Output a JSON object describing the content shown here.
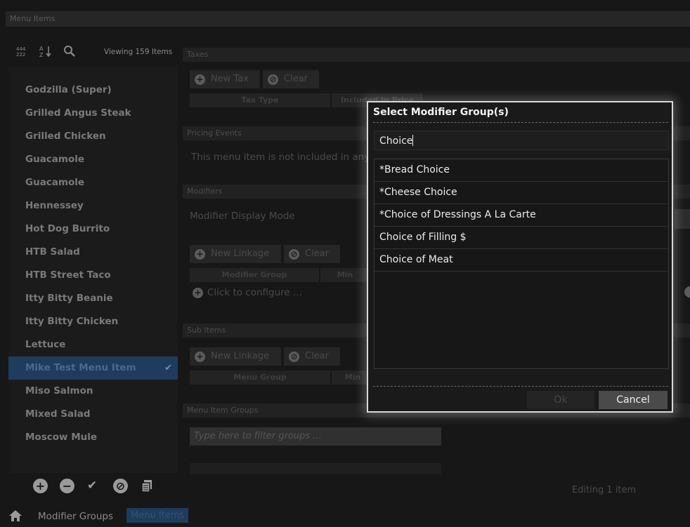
{
  "window": {
    "title": "Menu Items"
  },
  "list_panel": {
    "viewing": "Viewing 159 Items",
    "items": [
      {
        "label": "Godzilla (Super)",
        "selected": false
      },
      {
        "label": "Grilled Angus Steak",
        "selected": false
      },
      {
        "label": "Grilled Chicken",
        "selected": false
      },
      {
        "label": "Guacamole",
        "selected": false
      },
      {
        "label": "Guacamole",
        "selected": false
      },
      {
        "label": "Hennessey",
        "selected": false
      },
      {
        "label": "Hot Dog Burrito",
        "selected": false
      },
      {
        "label": "HTB Salad",
        "selected": false
      },
      {
        "label": "HTB Street Taco",
        "selected": false
      },
      {
        "label": "Itty Bitty Beanie",
        "selected": false
      },
      {
        "label": "Itty Bitty Chicken",
        "selected": false
      },
      {
        "label": "Lettuce",
        "selected": false
      },
      {
        "label": "Mike Test Menu Item",
        "selected": true
      },
      {
        "label": "Miso Salmon",
        "selected": false
      },
      {
        "label": "Mixed Salad",
        "selected": false
      },
      {
        "label": "Moscow Mule",
        "selected": false
      }
    ]
  },
  "footer": {
    "nav_modifier_groups": "Modifier Groups",
    "nav_menu_items": "Menu Items",
    "editing": "Editing 1 item"
  },
  "detail": {
    "taxes": {
      "header": "Taxes",
      "new_tax": "New Tax",
      "clear": "Clear",
      "col_tax_type": "Tax Type",
      "col_included": "Included In Price"
    },
    "pricing_events": {
      "header": "Pricing Events",
      "text": "This menu item is not included in any"
    },
    "modifiers": {
      "header": "Modifiers",
      "display_mode": "Modifier Display Mode",
      "new_linkage": "New Linkage",
      "clear": "Clear",
      "col_group": "Modifier Group",
      "col_min": "Min",
      "configure": "Click to configure ..."
    },
    "sub_items": {
      "header": "Sub Items",
      "new_linkage": "New Linkage",
      "clear": "Clear",
      "col_group": "Menu Group",
      "col_min": "Min"
    },
    "menu_item_groups": {
      "header": "Menu Item Groups",
      "filter_placeholder": "Type here to filter groups ..."
    }
  },
  "modal": {
    "title": "Select Modifier Group(s)",
    "search_value": "Choice",
    "results": [
      "*Bread Choice",
      "*Cheese Choice",
      "*Choice of Dressings A La Carte",
      "Choice of Filling $",
      "Choice of Meat"
    ],
    "ok": "Ok",
    "cancel": "Cancel"
  },
  "colors": {
    "selection": "#1e3c5c",
    "modal_border": "#d8d8d8",
    "background": "#171717"
  }
}
